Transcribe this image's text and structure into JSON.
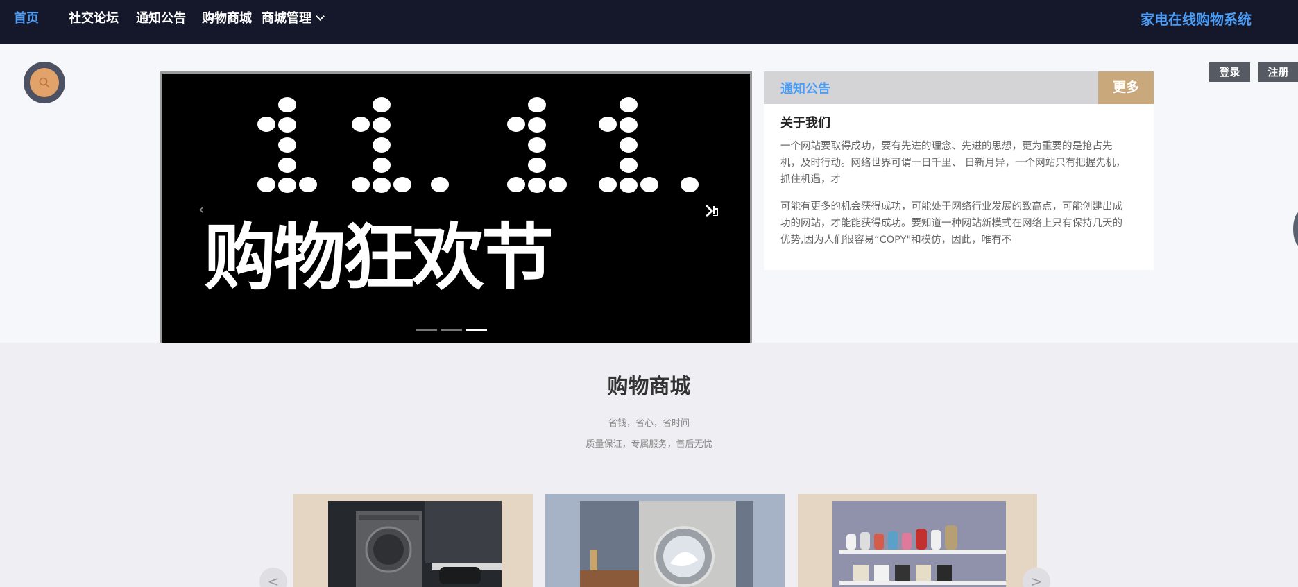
{
  "nav": {
    "items": [
      {
        "label": "首页",
        "active": true
      },
      {
        "label": "社交论坛",
        "active": false
      },
      {
        "label": "通知公告",
        "active": false
      },
      {
        "label": "购物商城",
        "active": false
      },
      {
        "label": "商城管理",
        "active": false
      }
    ],
    "site_title": "家电在线购物系统"
  },
  "auth": {
    "login": "登录",
    "register": "注册"
  },
  "banner": {
    "text": "购物狂欢节",
    "slide_count": 3,
    "active_slide": 3
  },
  "notice": {
    "title": "通知公告",
    "more": "更多",
    "subtitle": "关于我们",
    "paragraphs": [
      "一个网站要取得成功，要有先进的理念、先进的思想，更为重要的是抢占先机，及时行动。网络世界可谓一日千里、 日新月异，一个网站只有把握先机，抓住机遇，才",
      "可能有更多的机会获得成功，可能处于网络行业发展的致高点，可能创建出成功的网站，才能能获得成功。要知道一种网站新模式在网络上只有保持几天的优势,因为人们很容易“COPY\"和模仿，因此，唯有不"
    ]
  },
  "shop": {
    "title": "购物商城",
    "subtitle1": "省钱，省心，省时间",
    "subtitle2": "质量保证，专属服务，售后无忧",
    "prev": "<",
    "next": ">"
  },
  "colors": {
    "nav_bg": "#15182a",
    "accent_blue": "#4a9cf5",
    "more_gold": "#c9a97b",
    "search_orange": "#e2a36b"
  },
  "icons": [
    "search-icon",
    "chevron-down-icon",
    "arrow-right-icon",
    "arrow-left-icon"
  ]
}
